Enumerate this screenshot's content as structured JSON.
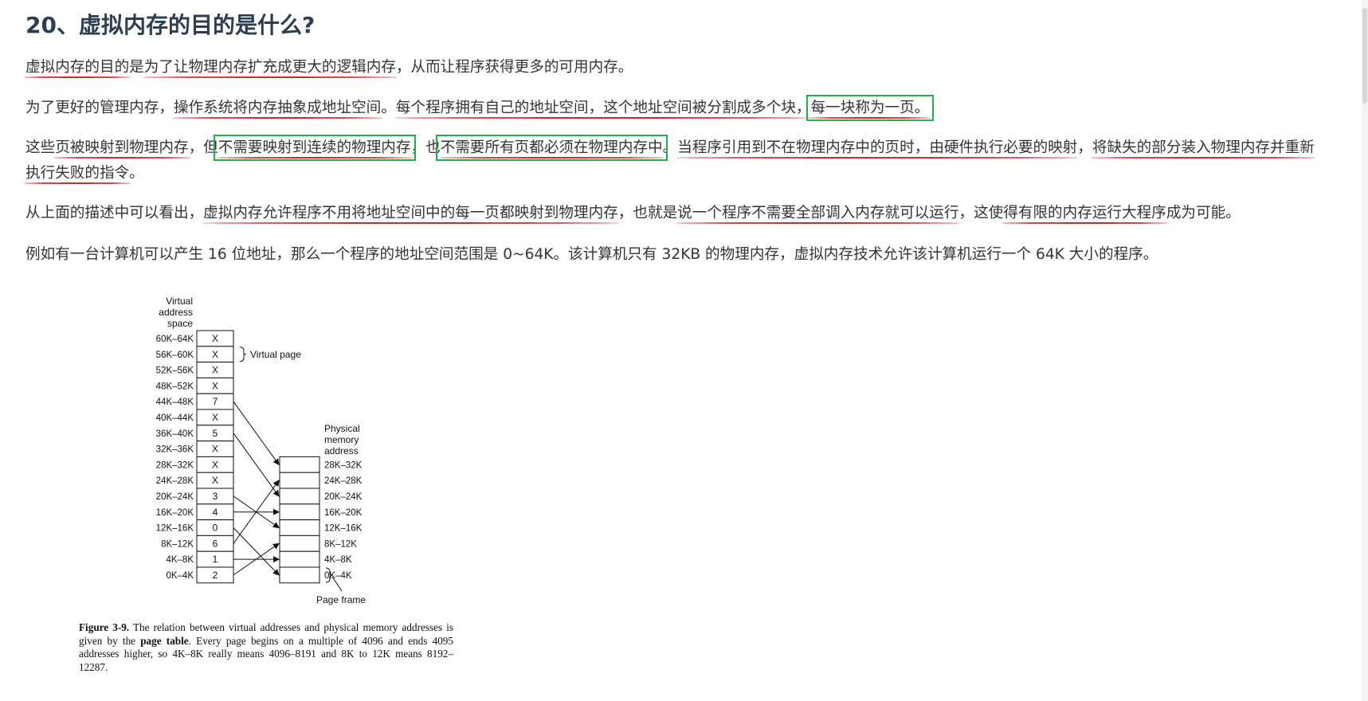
{
  "title": "20、虚拟内存的目的是什么?",
  "p1": {
    "s1": "虚拟内存的目的",
    "s2": "是",
    "s3": "为了让物理内存扩充成更大的逻辑内存",
    "s4": "，从而让程序获得更多的可用内存。"
  },
  "p2": {
    "s1": "为了更好的管理内存，",
    "s2": "操作系统将内存抽象成地址空间",
    "s3": "。",
    "s4": "每个程序拥有自己的地址空间，这个地址空间被分割成多个块，",
    "s5": "每一块称为一页。"
  },
  "p3": {
    "s1": "这些",
    "s2": "页被映射到物理内存",
    "s3": "，但",
    "s4": "不需要映射到连续的物理内存",
    "s5": "，也",
    "s6": "不需要所有页都必须在物理内存中",
    "s7": "。",
    "s8": "当程序引用到不在物理内存中的页时，由硬件执行必要的映射",
    "s9": "，",
    "s10": "将缺失的部分装入物理内存并重新",
    "s11": "执行失败的指令",
    "s12": "。"
  },
  "p4": {
    "s1": "从上面的描述中可以看出，",
    "s2": "虚拟内存允许程序不用将地址空间中的每一页都映射到物理内存",
    "s3": "，也就是",
    "s4": "说一个程序不需要全部调入内存就可以运行",
    "s5": "，这使",
    "s6": "得有限的内存运行大程序",
    "s7": "成为可能。"
  },
  "p5": "例如有一台计算机可以产生 16 位地址，那么一个程序的地址空间范围是 0~64K。该计算机只有 32KB 的物理内存，虚拟内存技术允许该计算机运行一个 64K 大小的程序。",
  "colors": {
    "underline_red": "#e0212e",
    "box_green": "#1fb24a",
    "title": "#2c3e50",
    "text": "#333333"
  },
  "figure": {
    "virtual_label": [
      "Virtual",
      "address",
      "space"
    ],
    "physical_label": [
      "Physical",
      "memory",
      "address"
    ],
    "virtual_page_label": "Virtual page",
    "page_frame_label": "Page frame",
    "virtual_ranges": [
      "60K–64K",
      "56K–60K",
      "52K–56K",
      "48K–52K",
      "44K–48K",
      "40K–44K",
      "36K–40K",
      "32K–36K",
      "28K–32K",
      "24K–28K",
      "20K–24K",
      "16K–20K",
      "12K–16K",
      "8K–12K",
      "4K–8K",
      "0K–4K"
    ],
    "virtual_values": [
      "X",
      "X",
      "X",
      "X",
      "7",
      "X",
      "5",
      "X",
      "X",
      "X",
      "3",
      "4",
      "0",
      "6",
      "1",
      "2"
    ],
    "physical_ranges": [
      "28K–32K",
      "24K–28K",
      "20K–24K",
      "16K–20K",
      "12K–16K",
      "8K–12K",
      "4K–8K",
      "0K–4K"
    ],
    "caption": {
      "figure_label": "Figure 3-9.",
      "text1": " The relation between virtual addresses and physical memory addresses is given by the ",
      "bold": "page table",
      "text2": ". Every page begins on a multiple of 4096 and ends 4095 addresses higher, so 4K–8K really means 4096–8191 and 8K to 12K means 8192–12287."
    }
  }
}
